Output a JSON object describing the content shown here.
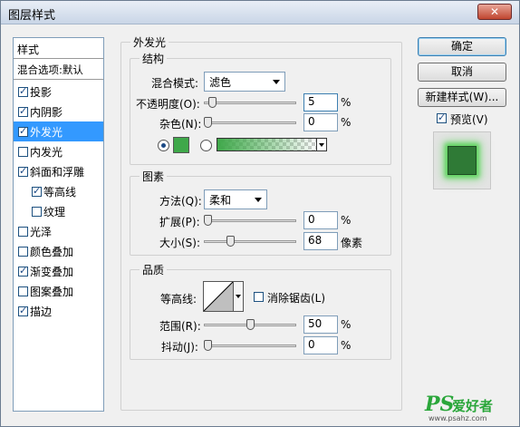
{
  "window": {
    "title": "图层样式",
    "close_glyph": "✕"
  },
  "styles_panel": {
    "header": "样式",
    "blend_options": "混合选项:默认",
    "items": [
      {
        "label": "投影",
        "checked": true,
        "selected": false,
        "indent": false
      },
      {
        "label": "内阴影",
        "checked": true,
        "selected": false,
        "indent": false
      },
      {
        "label": "外发光",
        "checked": true,
        "selected": true,
        "indent": false
      },
      {
        "label": "内发光",
        "checked": false,
        "selected": false,
        "indent": false
      },
      {
        "label": "斜面和浮雕",
        "checked": true,
        "selected": false,
        "indent": false
      },
      {
        "label": "等高线",
        "checked": true,
        "selected": false,
        "indent": true
      },
      {
        "label": "纹理",
        "checked": false,
        "selected": false,
        "indent": true
      },
      {
        "label": "光泽",
        "checked": false,
        "selected": false,
        "indent": false
      },
      {
        "label": "颜色叠加",
        "checked": false,
        "selected": false,
        "indent": false
      },
      {
        "label": "渐变叠加",
        "checked": true,
        "selected": false,
        "indent": false
      },
      {
        "label": "图案叠加",
        "checked": false,
        "selected": false,
        "indent": false
      },
      {
        "label": "描边",
        "checked": true,
        "selected": false,
        "indent": false
      }
    ]
  },
  "outer_glow": {
    "title": "外发光",
    "structure": {
      "title": "结构",
      "blend_mode_label": "混合模式:",
      "blend_mode_value": "滤色",
      "opacity_label": "不透明度(O):",
      "opacity_value": "5",
      "opacity_unit": "%",
      "opacity_level": 0.05,
      "noise_label": "杂色(N):",
      "noise_value": "0",
      "noise_unit": "%",
      "noise_level": 0,
      "color_mode": "solid",
      "color": "#3fa84a"
    },
    "elements": {
      "title": "图素",
      "technique_label": "方法(Q):",
      "technique_value": "柔和",
      "spread_label": "扩展(P):",
      "spread_value": "0",
      "spread_unit": "%",
      "spread_level": 0,
      "size_label": "大小(S):",
      "size_value": "68",
      "size_unit": "像素",
      "size_level": 0.27
    },
    "quality": {
      "title": "品质",
      "contour_label": "等高线:",
      "antialias_label": "消除锯齿(L)",
      "antialias_checked": false,
      "range_label": "范围(R):",
      "range_value": "50",
      "range_unit": "%",
      "range_level": 0.5,
      "jitter_label": "抖动(J):",
      "jitter_value": "0",
      "jitter_unit": "%",
      "jitter_level": 0
    }
  },
  "buttons": {
    "ok": "确定",
    "cancel": "取消",
    "new_style": "新建样式(W)...",
    "preview_label": "预览(V)",
    "preview_checked": true
  },
  "watermark": {
    "brand": "PS",
    "name": "爱好者",
    "url": "www.psahz.com"
  }
}
